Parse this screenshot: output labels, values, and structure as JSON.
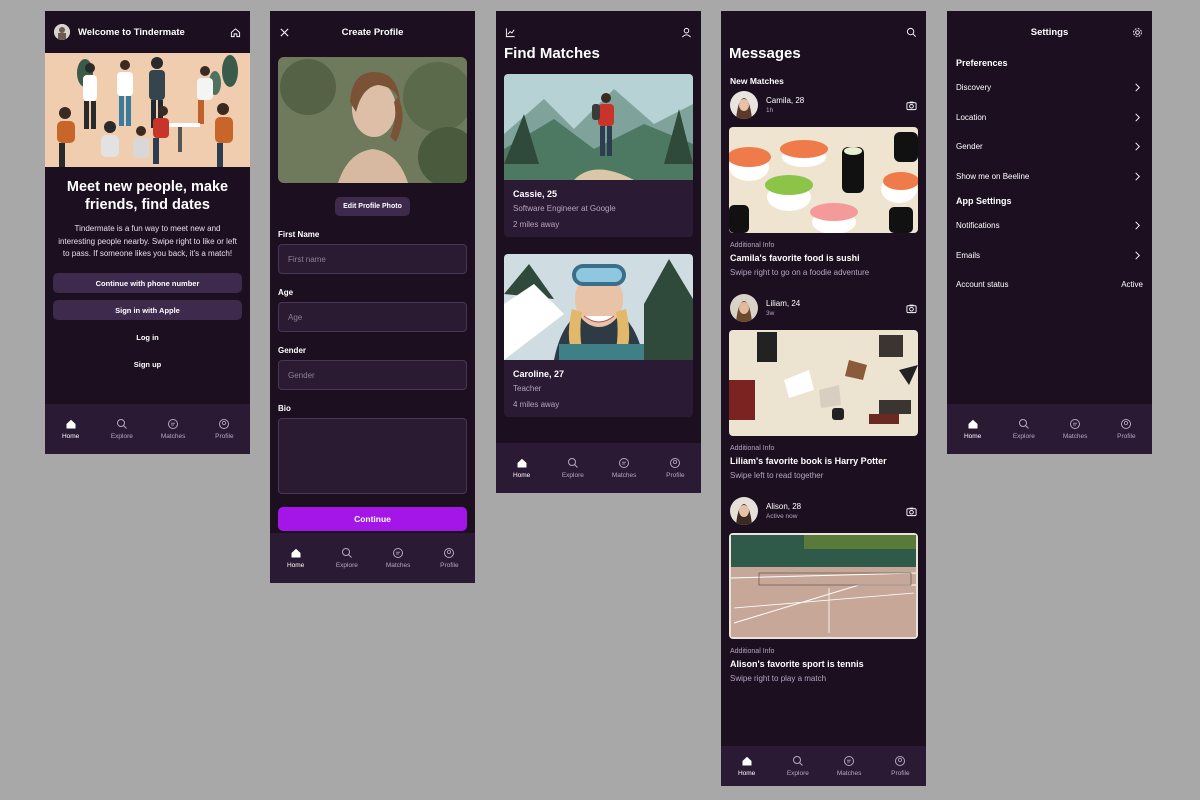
{
  "colors": {
    "page_bg": "#a8a8a8",
    "phone_bg": "#1c1020",
    "nav_bg": "#2b1a33",
    "accent": "#a416e8",
    "button_bg": "#3e2a4c"
  },
  "nav": [
    {
      "label": "Home",
      "icon": "home-icon"
    },
    {
      "label": "Explore",
      "icon": "search-icon"
    },
    {
      "label": "Matches",
      "icon": "chat-icon"
    },
    {
      "label": "Profile",
      "icon": "profile-icon"
    }
  ],
  "welcome": {
    "title": "Welcome to Tindermate",
    "headline": "Meet new people, make friends, find dates",
    "description": "Tindermate is a fun way to meet new and interesting people nearby. Swipe right to like or left to pass. If someone likes you back, it's a match!",
    "buttons": [
      "Continue with phone number",
      "Sign in with Apple",
      "Log in",
      "Sign up"
    ]
  },
  "create_profile": {
    "title": "Create Profile",
    "edit_photo": "Edit Profile Photo",
    "fields": [
      {
        "label": "First Name",
        "placeholder": "First name"
      },
      {
        "label": "Age",
        "placeholder": "Age"
      },
      {
        "label": "Gender",
        "placeholder": "Gender"
      },
      {
        "label": "Bio",
        "placeholder": ""
      }
    ],
    "continue": "Continue"
  },
  "find_matches": {
    "title": "Find Matches",
    "cards": [
      {
        "name": "Cassie, 25",
        "job": "Software Engineer at Google",
        "distance": "2 miles away"
      },
      {
        "name": "Caroline, 27",
        "job": "Teacher",
        "distance": "4 miles away"
      }
    ]
  },
  "messages": {
    "title": "Messages",
    "section": "New Matches",
    "items": [
      {
        "name": "Camila, 28",
        "time": "1h",
        "info_label": "Additional Info",
        "info_title": "Camila's favorite food is sushi",
        "info_sub": "Swipe right to go on a foodie adventure"
      },
      {
        "name": "Liliam, 24",
        "time": "3w",
        "info_label": "Additional Info",
        "info_title": "Liliam's favorite book is Harry Potter",
        "info_sub": "Swipe left to read together"
      },
      {
        "name": "Alison, 28",
        "time": "Active now",
        "info_label": "Additional Info",
        "info_title": "Alison's favorite sport is tennis",
        "info_sub": "Swipe right to play a match"
      }
    ]
  },
  "settings": {
    "title": "Settings",
    "preferences_title": "Preferences",
    "preferences": [
      "Discovery",
      "Location",
      "Gender",
      "Show me on Beeline"
    ],
    "app_settings_title": "App Settings",
    "app_settings": [
      "Notifications",
      "Emails"
    ],
    "account_status_label": "Account status",
    "account_status_value": "Active"
  }
}
